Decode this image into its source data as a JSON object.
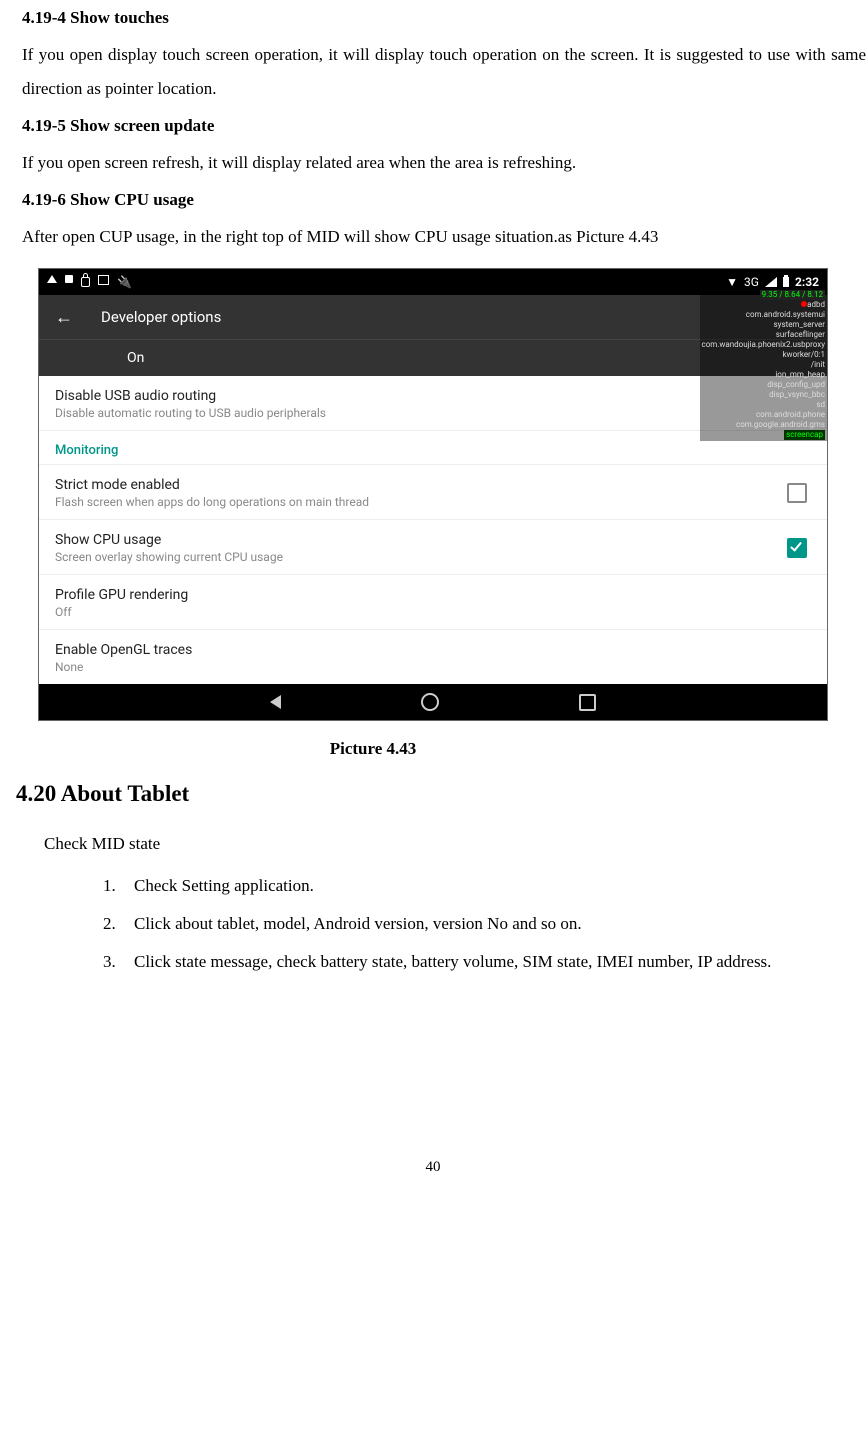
{
  "section_419_4": {
    "heading": "4.19-4 Show touches",
    "para": "If you open display touch screen operation, it will display touch operation on the screen. It is suggested to use with same direction as pointer location."
  },
  "section_419_5": {
    "heading": "4.19-5 Show screen update",
    "para": "If you open screen refresh, it will display related area when the area is refreshing."
  },
  "section_419_6": {
    "heading": "4.19-6 Show CPU usage",
    "para": "After open CUP usage, in the right top of MID will show CPU usage situation.as Picture 4.43"
  },
  "caption": "Picture 4.43",
  "section_420": {
    "heading": "4.20 About Tablet",
    "lead": "Check MID state",
    "items": [
      "Check Setting application.",
      "Click about tablet, model, Android version, version No and so on.",
      "Click state message, check battery state, battery volume, SIM state, IMEI number, IP address."
    ]
  },
  "page_number": "40",
  "screenshot": {
    "status": {
      "network": "3G",
      "time": "2:32"
    },
    "appbar_title": "Developer options",
    "on_label": "On",
    "settings": {
      "usb": {
        "title": "Disable USB audio routing",
        "sub": "Disable automatic routing to USB audio peripherals"
      },
      "monitoring_label": "Monitoring",
      "strict": {
        "title": "Strict mode enabled",
        "sub": "Flash screen when apps do long operations on main thread"
      },
      "cpu": {
        "title": "Show CPU usage",
        "sub": "Screen overlay showing current CPU usage"
      },
      "gpu": {
        "title": "Profile GPU rendering",
        "sub": "Off"
      },
      "opengl": {
        "title": "Enable OpenGL traces",
        "sub": "None"
      }
    },
    "overlay": {
      "top": "9.35 / 8.64 / 8.12",
      "lines": [
        "adbd",
        "com.android.systemui",
        "system_server",
        "surfaceflinger",
        "com.wandoujia.phoenix2.usbproxy",
        "kworker/0:1",
        "/init",
        "ion_mm_heap",
        "disp_config_upd",
        "disp_vsync_bbc",
        "sd",
        "com.android.phone",
        "com.google.android.gms",
        "screencap"
      ]
    }
  }
}
